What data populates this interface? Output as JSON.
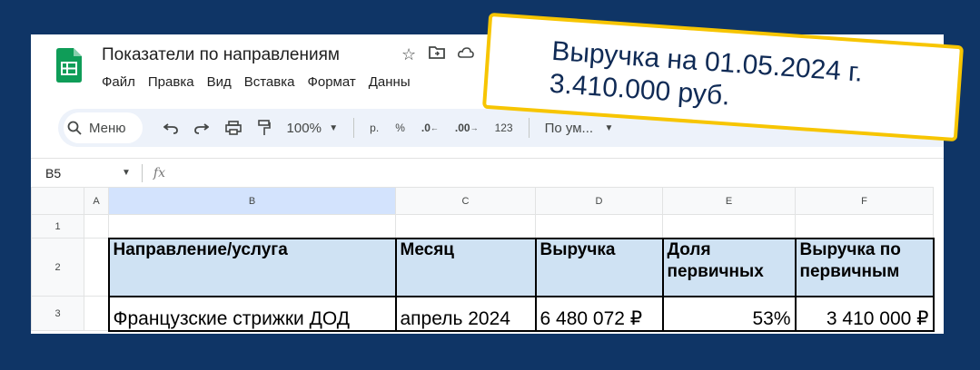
{
  "app": {
    "title": "Показатели по направлениям",
    "menu": [
      "Файл",
      "Правка",
      "Вид",
      "Вставка",
      "Формат",
      "Данны"
    ]
  },
  "toolbar": {
    "search_label": "Меню",
    "zoom": "100%",
    "currency": "р.",
    "percent": "%",
    "dec_decrease": ".0",
    "dec_increase": ".00",
    "number_format": "123",
    "font": "По ум..."
  },
  "formula_bar": {
    "cell_ref": "B5",
    "fx": "fx"
  },
  "grid": {
    "columns": [
      "A",
      "B",
      "C",
      "D",
      "E",
      "F"
    ],
    "rows": [
      "1",
      "2",
      "3"
    ],
    "header_row": {
      "B": "Направление/услуга",
      "C": "Месяц",
      "D": "Выручка",
      "E_line1": "Доля",
      "E_line2": "первичных",
      "F_line1": "Выручка по",
      "F_line2": "первичным"
    },
    "data_row": {
      "B": "Французские стрижки ДОД",
      "C": "апрель 2024",
      "D": "6 480 072 ₽",
      "E": "53%",
      "F": "3 410 000 ₽"
    }
  },
  "callout": {
    "line1": "Выручка на 01.05.2024 г.",
    "line2": "3.410.000 руб."
  },
  "colors": {
    "background": "#0f3566",
    "sheets_green": "#0f9d58",
    "header_fill": "#cfe2f3",
    "callout_border": "#f7c500",
    "callout_text": "#0f2a55"
  }
}
